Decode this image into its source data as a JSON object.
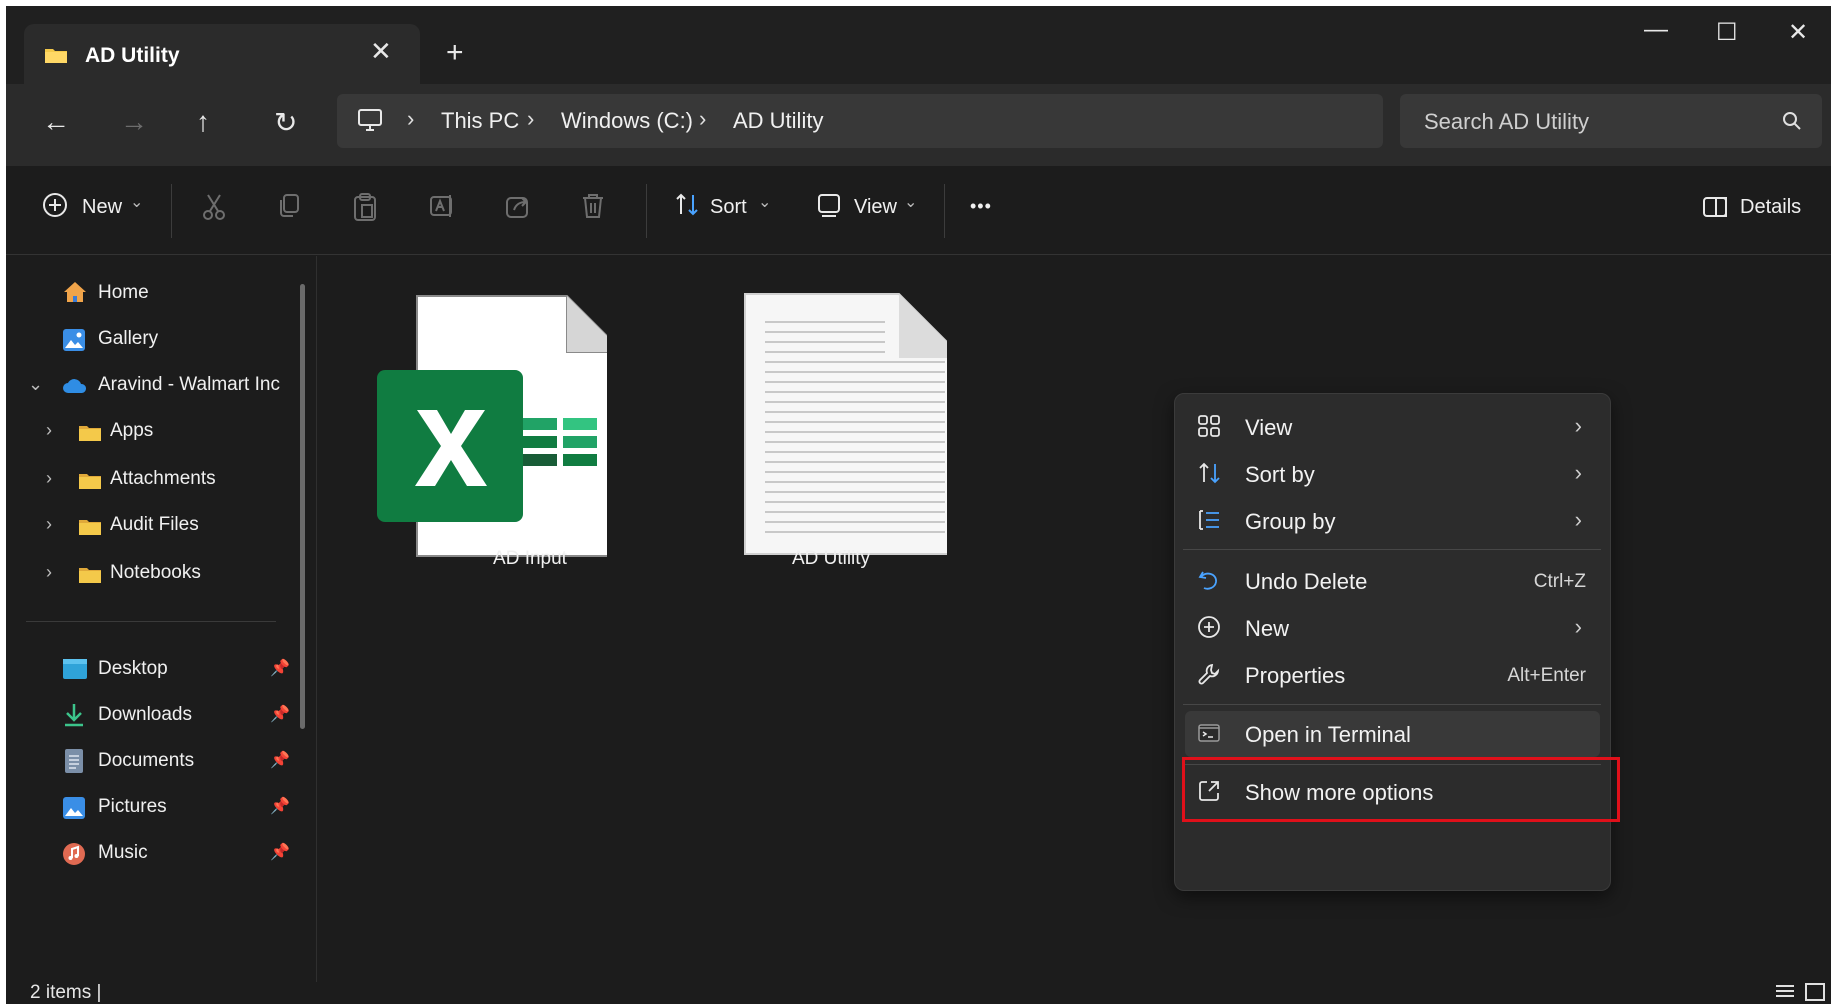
{
  "tab": {
    "title": "AD Utility",
    "close": "✕",
    "new_tab": "+"
  },
  "window_controls": {
    "minimize": "—",
    "maximize": "☐",
    "close": "✕"
  },
  "nav": {
    "back": "←",
    "forward": "→",
    "up": "↑",
    "refresh": "↻"
  },
  "breadcrumb": [
    "This PC",
    "Windows (C:)",
    "AD Utility"
  ],
  "breadcrumb_sep": "›",
  "search": {
    "placeholder": "Search AD Utility"
  },
  "toolbar": {
    "new_label": "New",
    "sort_label": "Sort",
    "view_label": "View",
    "more_label": "•••",
    "details_label": "Details",
    "chevron": "⌄"
  },
  "sidebar": {
    "home": "Home",
    "gallery": "Gallery",
    "cloud": "Aravind - Walmart Inc",
    "folders": [
      "Apps",
      "Attachments",
      "Audit Files",
      "Notebooks"
    ],
    "pinned": [
      "Desktop",
      "Downloads",
      "Documents",
      "Pictures",
      "Music"
    ],
    "pin_glyph": "📌"
  },
  "files": [
    {
      "name": "AD Input",
      "icon": "excel-file-icon"
    },
    {
      "name": "AD Utility",
      "icon": "text-file-icon"
    }
  ],
  "context_menu": {
    "view": "View",
    "sort_by": "Sort by",
    "group_by": "Group by",
    "undo_delete": "Undo Delete",
    "undo_shortcut": "Ctrl+Z",
    "new": "New",
    "properties": "Properties",
    "properties_shortcut": "Alt+Enter",
    "open_terminal": "Open in Terminal",
    "show_more": "Show more options",
    "submenu_arrow": "›"
  },
  "status": {
    "items": "2 items  |"
  },
  "colors": {
    "highlight_box": "#e0101a",
    "excel_green": "#107c41",
    "folder_yellow": "#f4c94a"
  }
}
